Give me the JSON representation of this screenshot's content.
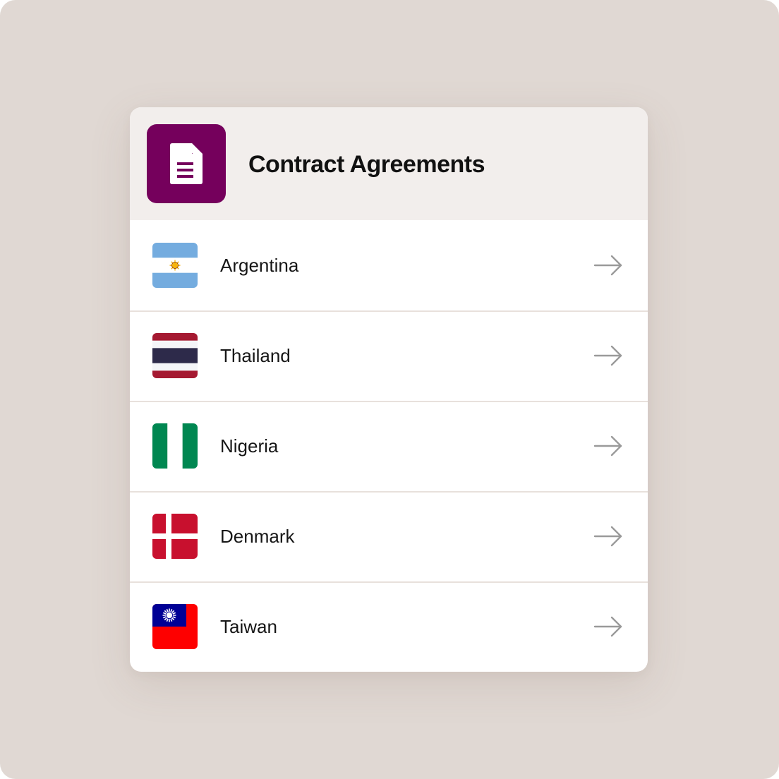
{
  "card": {
    "title": "Contract Agreements",
    "icon": "document-icon",
    "icon_bg": "#75005c"
  },
  "countries": [
    {
      "name": "Argentina",
      "flag": "argentina-flag-icon",
      "action_icon": "arrow-right-icon"
    },
    {
      "name": "Thailand",
      "flag": "thailand-flag-icon",
      "action_icon": "arrow-right-icon"
    },
    {
      "name": "Nigeria",
      "flag": "nigeria-flag-icon",
      "action_icon": "arrow-right-icon"
    },
    {
      "name": "Denmark",
      "flag": "denmark-flag-icon",
      "action_icon": "arrow-right-icon"
    },
    {
      "name": "Taiwan",
      "flag": "taiwan-flag-icon",
      "action_icon": "arrow-right-icon"
    }
  ],
  "colors": {
    "background": "#e0d8d3",
    "header_bg": "#f2eeec",
    "divider": "#e8e1dc",
    "arrow": "#9a9a9a"
  }
}
